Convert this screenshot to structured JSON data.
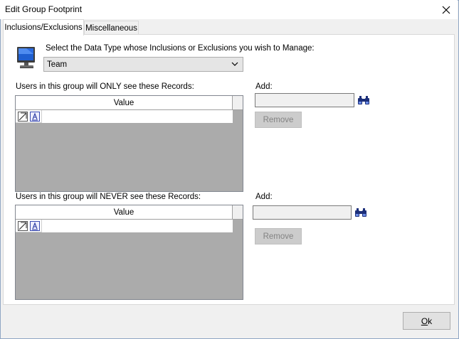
{
  "window": {
    "title": "Edit Group Footprint"
  },
  "tabs": [
    {
      "label": "Inclusions/Exclusions",
      "active": true
    },
    {
      "label": "Miscellaneous",
      "active": false
    }
  ],
  "data_type": {
    "prompt": "Select the Data Type whose Inclusions or Exclusions you wish to Manage:",
    "selected": "Team",
    "icon": "monitor-icon"
  },
  "inclusions": {
    "label": "Users in this group will ONLY see these Records:",
    "column_header": "Value",
    "add_label": "Add:",
    "add_value": "",
    "remove_label": "Remove"
  },
  "exclusions": {
    "label": "Users in this group will NEVER see these Records:",
    "column_header": "Value",
    "add_label": "Add:",
    "add_value": "",
    "remove_label": "Remove"
  },
  "footer": {
    "ok_key": "O",
    "ok_rest": "k"
  },
  "colors": {
    "grid_empty": "#ababab",
    "button_disabled": "#cccccc",
    "accent_border": "#8fa6c4"
  }
}
